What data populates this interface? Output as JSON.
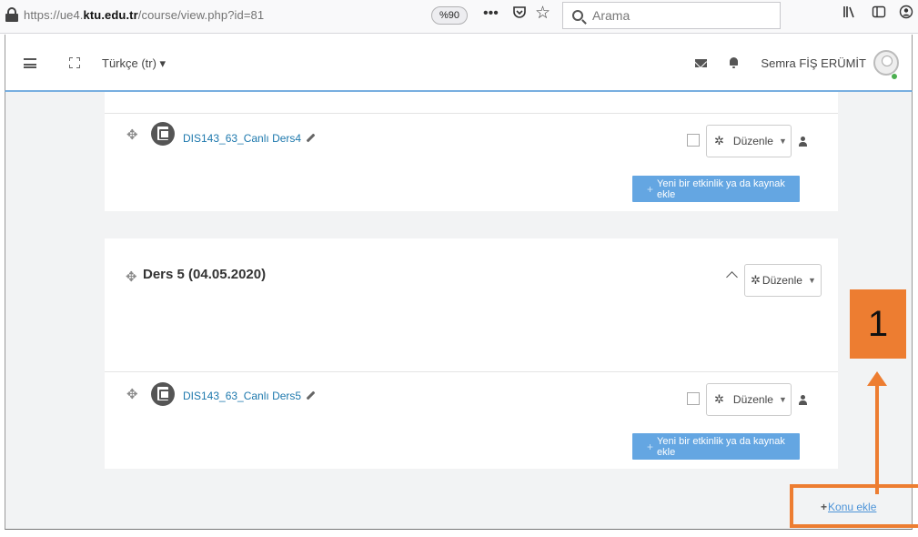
{
  "browser": {
    "url_prefix": "https://ue4.",
    "url_domain": "ktu.edu.tr",
    "url_path": "/course/view.php?id=81",
    "zoom": "%90",
    "search_placeholder": "Arama"
  },
  "navbar": {
    "language": "Türkçe (tr) ▾",
    "user_name": "Semra FİŞ ERÜMİT"
  },
  "sections": [
    {
      "title": "",
      "activity": {
        "name": "DIS143_63_Canlı Ders4",
        "edit_label": "Düzenle"
      },
      "add_button": "Yeni bir etkinlik ya da kaynak ekle"
    },
    {
      "title": "Ders 5 (04.05.2020)",
      "section_edit_label": "Düzenle",
      "activity": {
        "name": "DIS143_63_Canlı Ders5",
        "edit_label": "Düzenle"
      },
      "add_button": "Yeni bir etkinlik ya da kaynak ekle"
    }
  ],
  "add_topic": "Konu ekle",
  "annotation": {
    "number": "1",
    "color": "#ed7d31"
  },
  "colors": {
    "link": "#1d78ad",
    "add_button": "#64a6e2",
    "accent_border": "#78afe0"
  }
}
